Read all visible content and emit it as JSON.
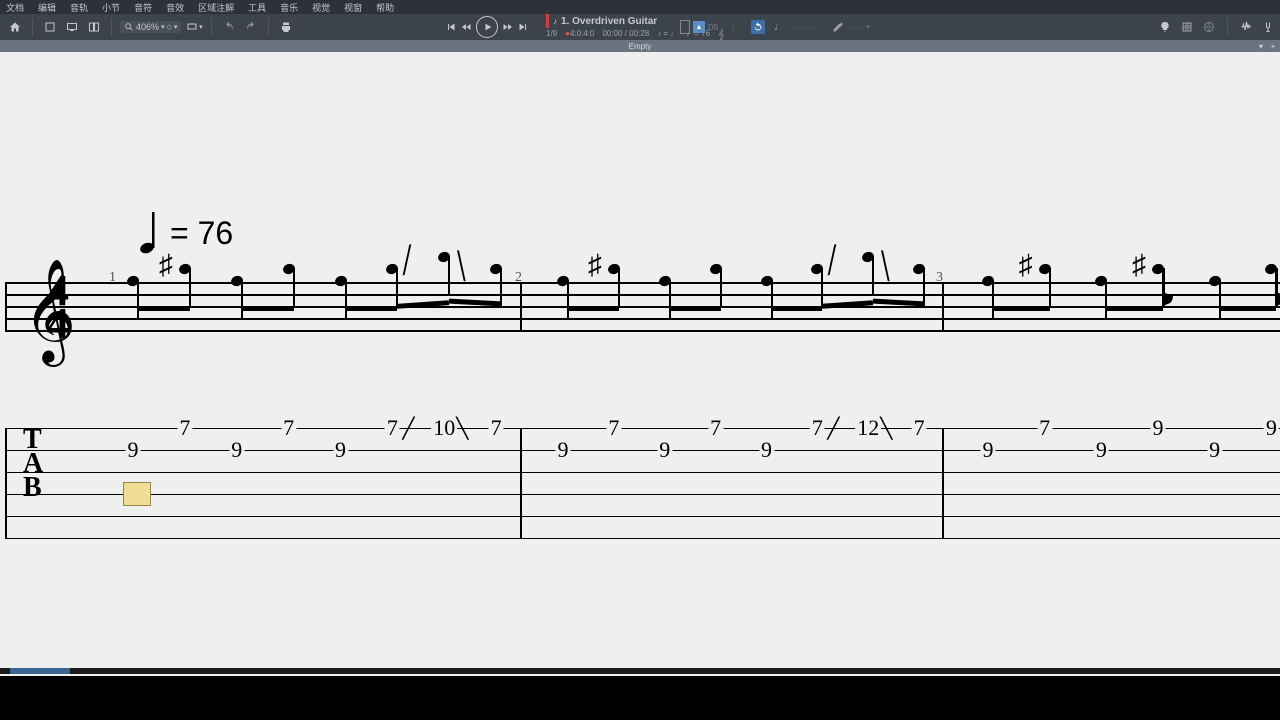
{
  "menu": [
    "文档",
    "编辑",
    "音轨",
    "小节",
    "音符",
    "音效",
    "区域注解",
    "工具",
    "音乐",
    "视觉",
    "视窗",
    "帮助"
  ],
  "zoom": "406%",
  "track": {
    "title": "1. Overdriven Guitar",
    "bar_pos": "1/9",
    "sig": "4:0:4:0",
    "time": "00:00 / 00:28",
    "tempo_note": "♪ = ♩",
    "tempo_val": "♩= 76",
    "note_pitch": "D5"
  },
  "tab_title": "Empty",
  "tempo": {
    "bpm": "76"
  },
  "bar_numbers": [
    "1",
    "2",
    "3"
  ],
  "tab_data": {
    "measures": [
      {
        "notes": [
          {
            "s": 2,
            "f": "9"
          },
          {
            "s": 1,
            "f": "7"
          },
          {
            "s": 2,
            "f": "9"
          },
          {
            "s": 1,
            "f": "7"
          },
          {
            "s": 2,
            "f": "9"
          },
          {
            "s": 1,
            "f": "7",
            "slide_up": "10",
            "slide_dn": "7"
          }
        ]
      },
      {
        "notes": [
          {
            "s": 2,
            "f": "9"
          },
          {
            "s": 1,
            "f": "7"
          },
          {
            "s": 2,
            "f": "9"
          },
          {
            "s": 1,
            "f": "7"
          },
          {
            "s": 2,
            "f": "9"
          },
          {
            "s": 1,
            "f": "7",
            "slide_up": "12",
            "slide_dn": "7"
          }
        ]
      },
      {
        "notes": [
          {
            "s": 2,
            "f": "9"
          },
          {
            "s": 1,
            "f": "7"
          },
          {
            "s": 2,
            "f": "9"
          },
          {
            "s": 1,
            "f": "9"
          },
          {
            "s": 2,
            "f": "9"
          },
          {
            "s": 1,
            "f": "9"
          }
        ]
      }
    ]
  }
}
